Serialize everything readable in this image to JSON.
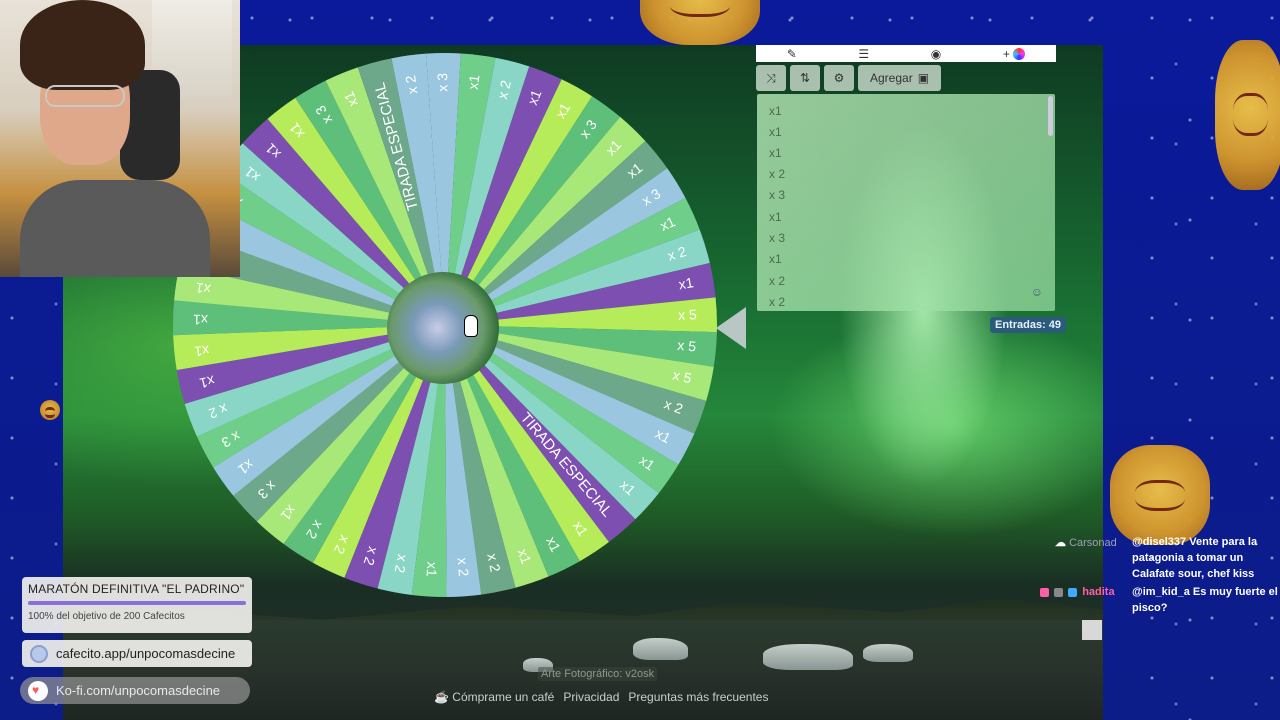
{
  "wheel": {
    "center_color": "#6a9a6a",
    "segment_colors": [
      "#9bc6e0",
      "#6fcf8a",
      "#8ad6c6",
      "#7c4fb0",
      "#b6ec5a",
      "#5dbf7a",
      "#a8e878",
      "#6ea88a"
    ],
    "labels": [
      "x 3",
      "x1",
      "x 2",
      "x1",
      "x1",
      "x 3",
      "x1",
      "x1",
      "x 3",
      "x1",
      "x 2",
      "x1",
      "x 5",
      "x 5",
      "x 5",
      "x 2",
      "x1",
      "x1",
      "x1",
      "TIRADA ESPECIAL",
      "x1",
      "x1",
      "x1",
      "x 2",
      "x 2",
      "x1",
      "x 2",
      "x 2",
      "x 2",
      "x 2",
      "x1",
      "x 3",
      "x1",
      "x 3",
      "x 2",
      "x1",
      "x1",
      "x1",
      "x1",
      "x1",
      "x1",
      "x1",
      "x1",
      "x1",
      "x1",
      "x 3",
      "x1",
      "TIRADA ESPECIAL",
      "x 2"
    ]
  },
  "toolbar": {
    "add_label": "Agregar",
    "icons": [
      "pencil-icon",
      "checklist-icon",
      "eye-slash-icon",
      "plus-icon",
      "shuffle-icon",
      "sort-icon",
      "gear-icon",
      "image-icon"
    ]
  },
  "entries": {
    "items": [
      "x1",
      "x1",
      "x1",
      "x 2",
      "x 3",
      "x1",
      "x 3",
      "x1",
      "x 2",
      "x 2"
    ],
    "count_label": "Entradas: 49"
  },
  "footer": {
    "photo_credit": "Arte Fotográfico: v2osk",
    "coffee_label": "Cómprame un café",
    "privacy_label": "Privacidad",
    "faq_label": "Preguntas más frecuentes"
  },
  "overlay": {
    "marathon_title": "MARATÓN DEFINITIVA \"EL PADRINO\"",
    "marathon_progress_text": "100% del objetivo de 200 Cafecitos",
    "marathon_progress": 1.0,
    "cafecito_link": "cafecito.app/unpocomasdecine",
    "kofi_link": "Ko-fi.com/unpocomasdecine"
  },
  "chat": {
    "messages": [
      {
        "user": "Carsonad",
        "text": ""
      },
      {
        "user": "@disel337",
        "text": "Vente para la"
      },
      {
        "user": "",
        "text": "patagonia a tomar un"
      },
      {
        "user": "",
        "text": "Calafate sour, chef kiss"
      },
      {
        "user": "hadita",
        "text": "@im_kid_a Es muy fuerte el"
      },
      {
        "user": "",
        "text": "pisco?"
      }
    ]
  }
}
